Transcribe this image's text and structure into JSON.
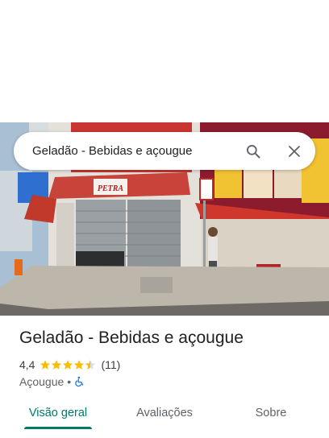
{
  "search": {
    "query": "Geladão - Bebidas e açougue"
  },
  "photo": {
    "signage_text": "PETRA"
  },
  "place": {
    "title": "Geladão - Bebidas e açougue",
    "rating": "4,4",
    "stars_value": 4.4,
    "stars_max": 5,
    "review_count": "(11)",
    "category": "Açougue",
    "separator": "•",
    "accessibility_icon": "wheelchair-icon"
  },
  "tabs": [
    {
      "label": "Visão geral",
      "active": true
    },
    {
      "label": "Avaliações",
      "active": false
    },
    {
      "label": "Sobre",
      "active": false
    }
  ],
  "colors": {
    "accent": "#00796b",
    "star": "#fbbc04",
    "star_empty": "#dadce0",
    "accessibility_blue": "#1a73e8"
  }
}
